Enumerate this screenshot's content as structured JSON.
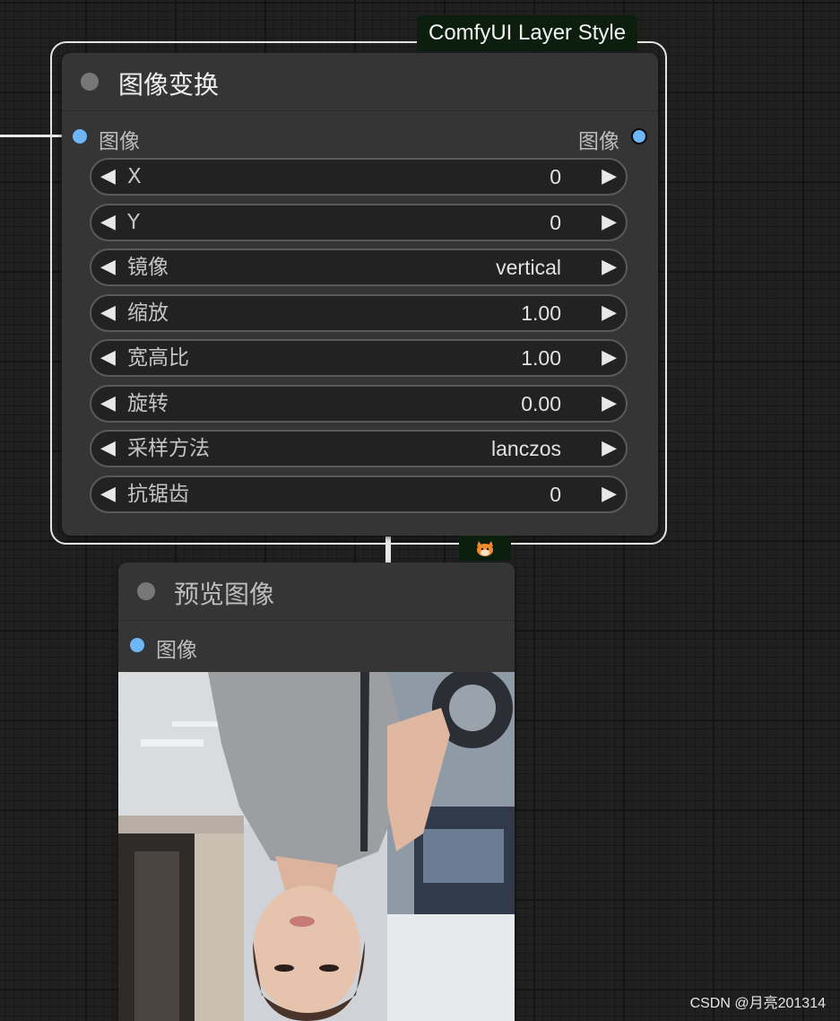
{
  "group": {
    "title": "ComfyUI Layer Style"
  },
  "transform_node": {
    "title": "图像变换",
    "input_label": "图像",
    "output_label": "图像",
    "widgets": [
      {
        "label": "X",
        "value": "0"
      },
      {
        "label": "Y",
        "value": "0"
      },
      {
        "label": "镜像",
        "value": "vertical"
      },
      {
        "label": "缩放",
        "value": "1.00"
      },
      {
        "label": "宽高比",
        "value": "1.00"
      },
      {
        "label": "旋转",
        "value": "0.00"
      },
      {
        "label": "采样方法",
        "value": "lanczos"
      },
      {
        "label": "抗锯齿",
        "value": "0"
      }
    ]
  },
  "preview_node": {
    "title": "预览图像",
    "input_label": "图像"
  },
  "icons": {
    "decrement": "◀",
    "increment": "▶",
    "badge": "fox-icon"
  },
  "colors": {
    "slot": "#6db6f7",
    "group_title_bg": "#0c1f0f",
    "node_bg": "#353535"
  },
  "watermark": "CSDN @月亮201314"
}
